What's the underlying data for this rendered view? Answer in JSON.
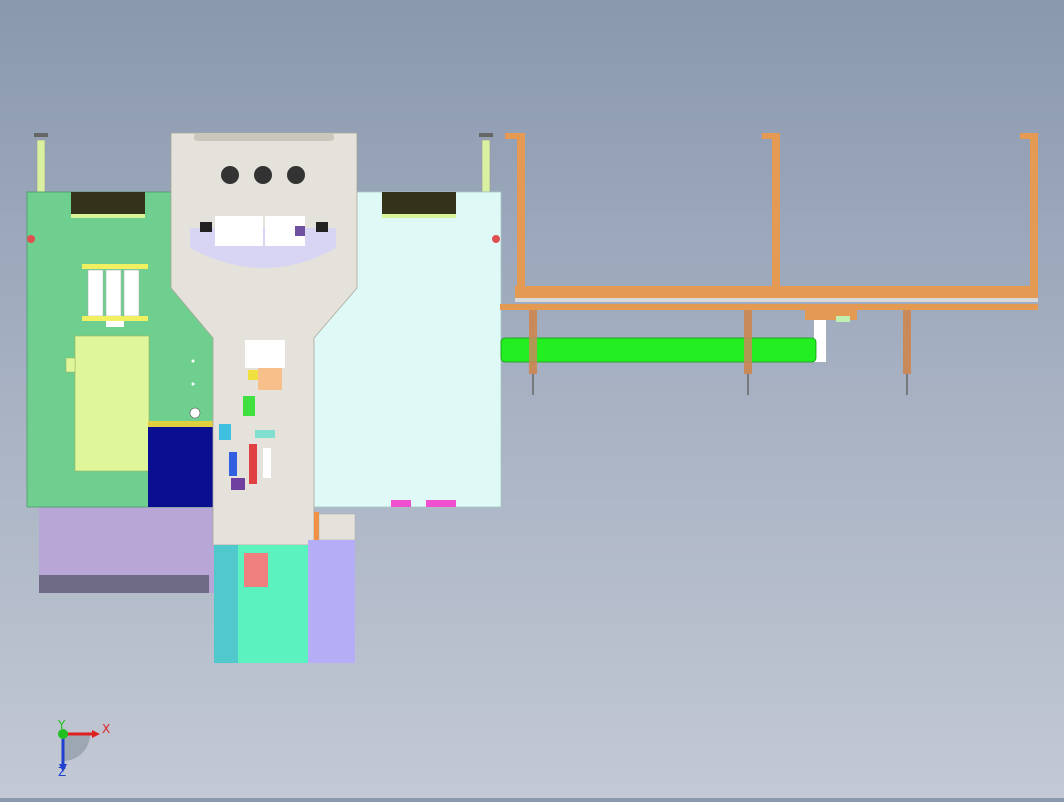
{
  "viewport": {
    "background_top": "#8a98ae",
    "background_bottom": "#c3c9d4"
  },
  "model": {
    "left_panel_color": "#6fcf8f",
    "center_body_color": "#e4e2db",
    "right_panel_color": "#dffaf6",
    "conveyor_frame_color": "#e49a52",
    "green_tube_color": "#22ee22",
    "blue_block_color": "#0a0f92",
    "lavender_block_color": "#b7a6d6",
    "teal_block_color": "#5cf2c0",
    "periwinkle_block_color": "#b5adf5",
    "yellow_block_color": "#dff79a"
  },
  "triad": {
    "x_label": "X",
    "y_label": "Y",
    "z_label": "Z",
    "x_color": "#e02020",
    "y_color": "#20c020",
    "z_color": "#2040d0"
  }
}
